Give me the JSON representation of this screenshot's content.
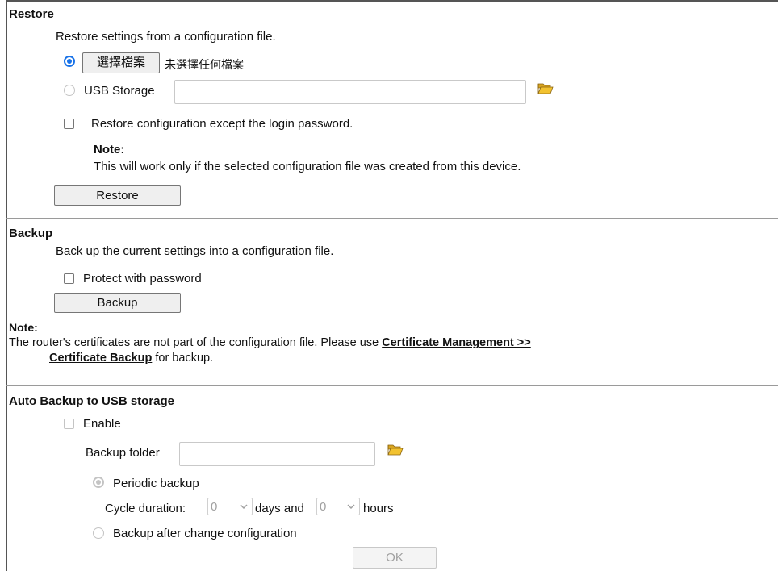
{
  "restore": {
    "heading": "Restore",
    "description": "Restore settings from a configuration file.",
    "choose_file_button": "選擇檔案",
    "no_file_text": "未選擇任何檔案",
    "usb_storage_label": "USB Storage",
    "usb_storage_value": "",
    "except_password_label": "Restore configuration except the login password.",
    "note_title": "Note:",
    "note_text": "This will work only if the selected configuration file was created from this device.",
    "restore_button": "Restore"
  },
  "backup": {
    "heading": "Backup",
    "description": "Back up the current settings into a configuration file.",
    "protect_label": "Protect with password",
    "backup_button": "Backup",
    "note_title": "Note:",
    "note_text_1": "The router's certificates are not part of the configuration file. Please use",
    "note_link_1": "Certificate Management >>",
    "note_link_2": "Certificate Backup",
    "note_text_2": "for backup."
  },
  "auto_backup": {
    "heading": "Auto Backup to USB storage",
    "enable_label": "Enable",
    "folder_label": "Backup folder",
    "folder_value": "",
    "periodic_label": "Periodic backup",
    "cycle_label": "Cycle duration:",
    "days_value": "0",
    "days_label": "days and",
    "hours_value": "0",
    "hours_label": "hours",
    "after_change_label": "Backup after change configuration",
    "ok_button": "OK"
  },
  "icons": {
    "folder": "folder-open-icon",
    "chevron": "chevron-down-icon"
  },
  "colors": {
    "radio_accent": "#1a73e8",
    "folder_yellow": "#f2c230"
  }
}
